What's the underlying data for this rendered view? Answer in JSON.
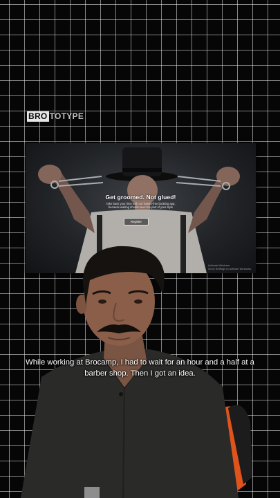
{
  "brand": {
    "part1": "BRO",
    "part2": "TOTYPE"
  },
  "website": {
    "title": "Get groomed. Not glued!",
    "subtitle": "Take back your time with our hassle-free booking app, because waiting should never be part of your style",
    "button_label": "Register",
    "watermark_line1": "Activate Windows",
    "watermark_line2": "Go to Settings to activate Windows."
  },
  "caption": "While working at Brocamp, I had to wait for an hour and a half at a barber shop. Then I got an idea.",
  "colors": {
    "chair_orange": "#e0531c",
    "shirt": "#2a2a29"
  }
}
